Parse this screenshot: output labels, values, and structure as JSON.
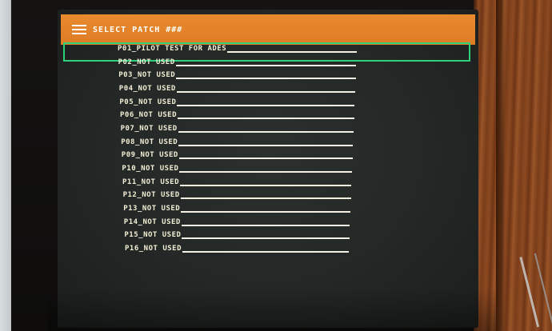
{
  "header": {
    "title": "SELECT PATCH ###",
    "menu_icon": "hamburger-menu-icon",
    "background_color": "#e0802a",
    "text_color": "#ffffff"
  },
  "selection": {
    "selected_index": 0,
    "highlight_color": "#2ed07a"
  },
  "patches": [
    {
      "label": "P01_PILOT TEST FOR ADES"
    },
    {
      "label": "P02_NOT USED"
    },
    {
      "label": "P03_NOT USED"
    },
    {
      "label": "P04_NOT USED"
    },
    {
      "label": "P05_NOT USED"
    },
    {
      "label": "P06_NOT USED"
    },
    {
      "label": "P07_NOT USED"
    },
    {
      "label": "P08_NOT USED"
    },
    {
      "label": "P09_NOT USED"
    },
    {
      "label": "P10_NOT USED"
    },
    {
      "label": "P11_NOT USED"
    },
    {
      "label": "P12_NOT USED"
    },
    {
      "label": "P13_NOT USED"
    },
    {
      "label": "P14_NOT USED"
    },
    {
      "label": "P15_NOT USED"
    },
    {
      "label": "P16_NOT USED"
    }
  ]
}
